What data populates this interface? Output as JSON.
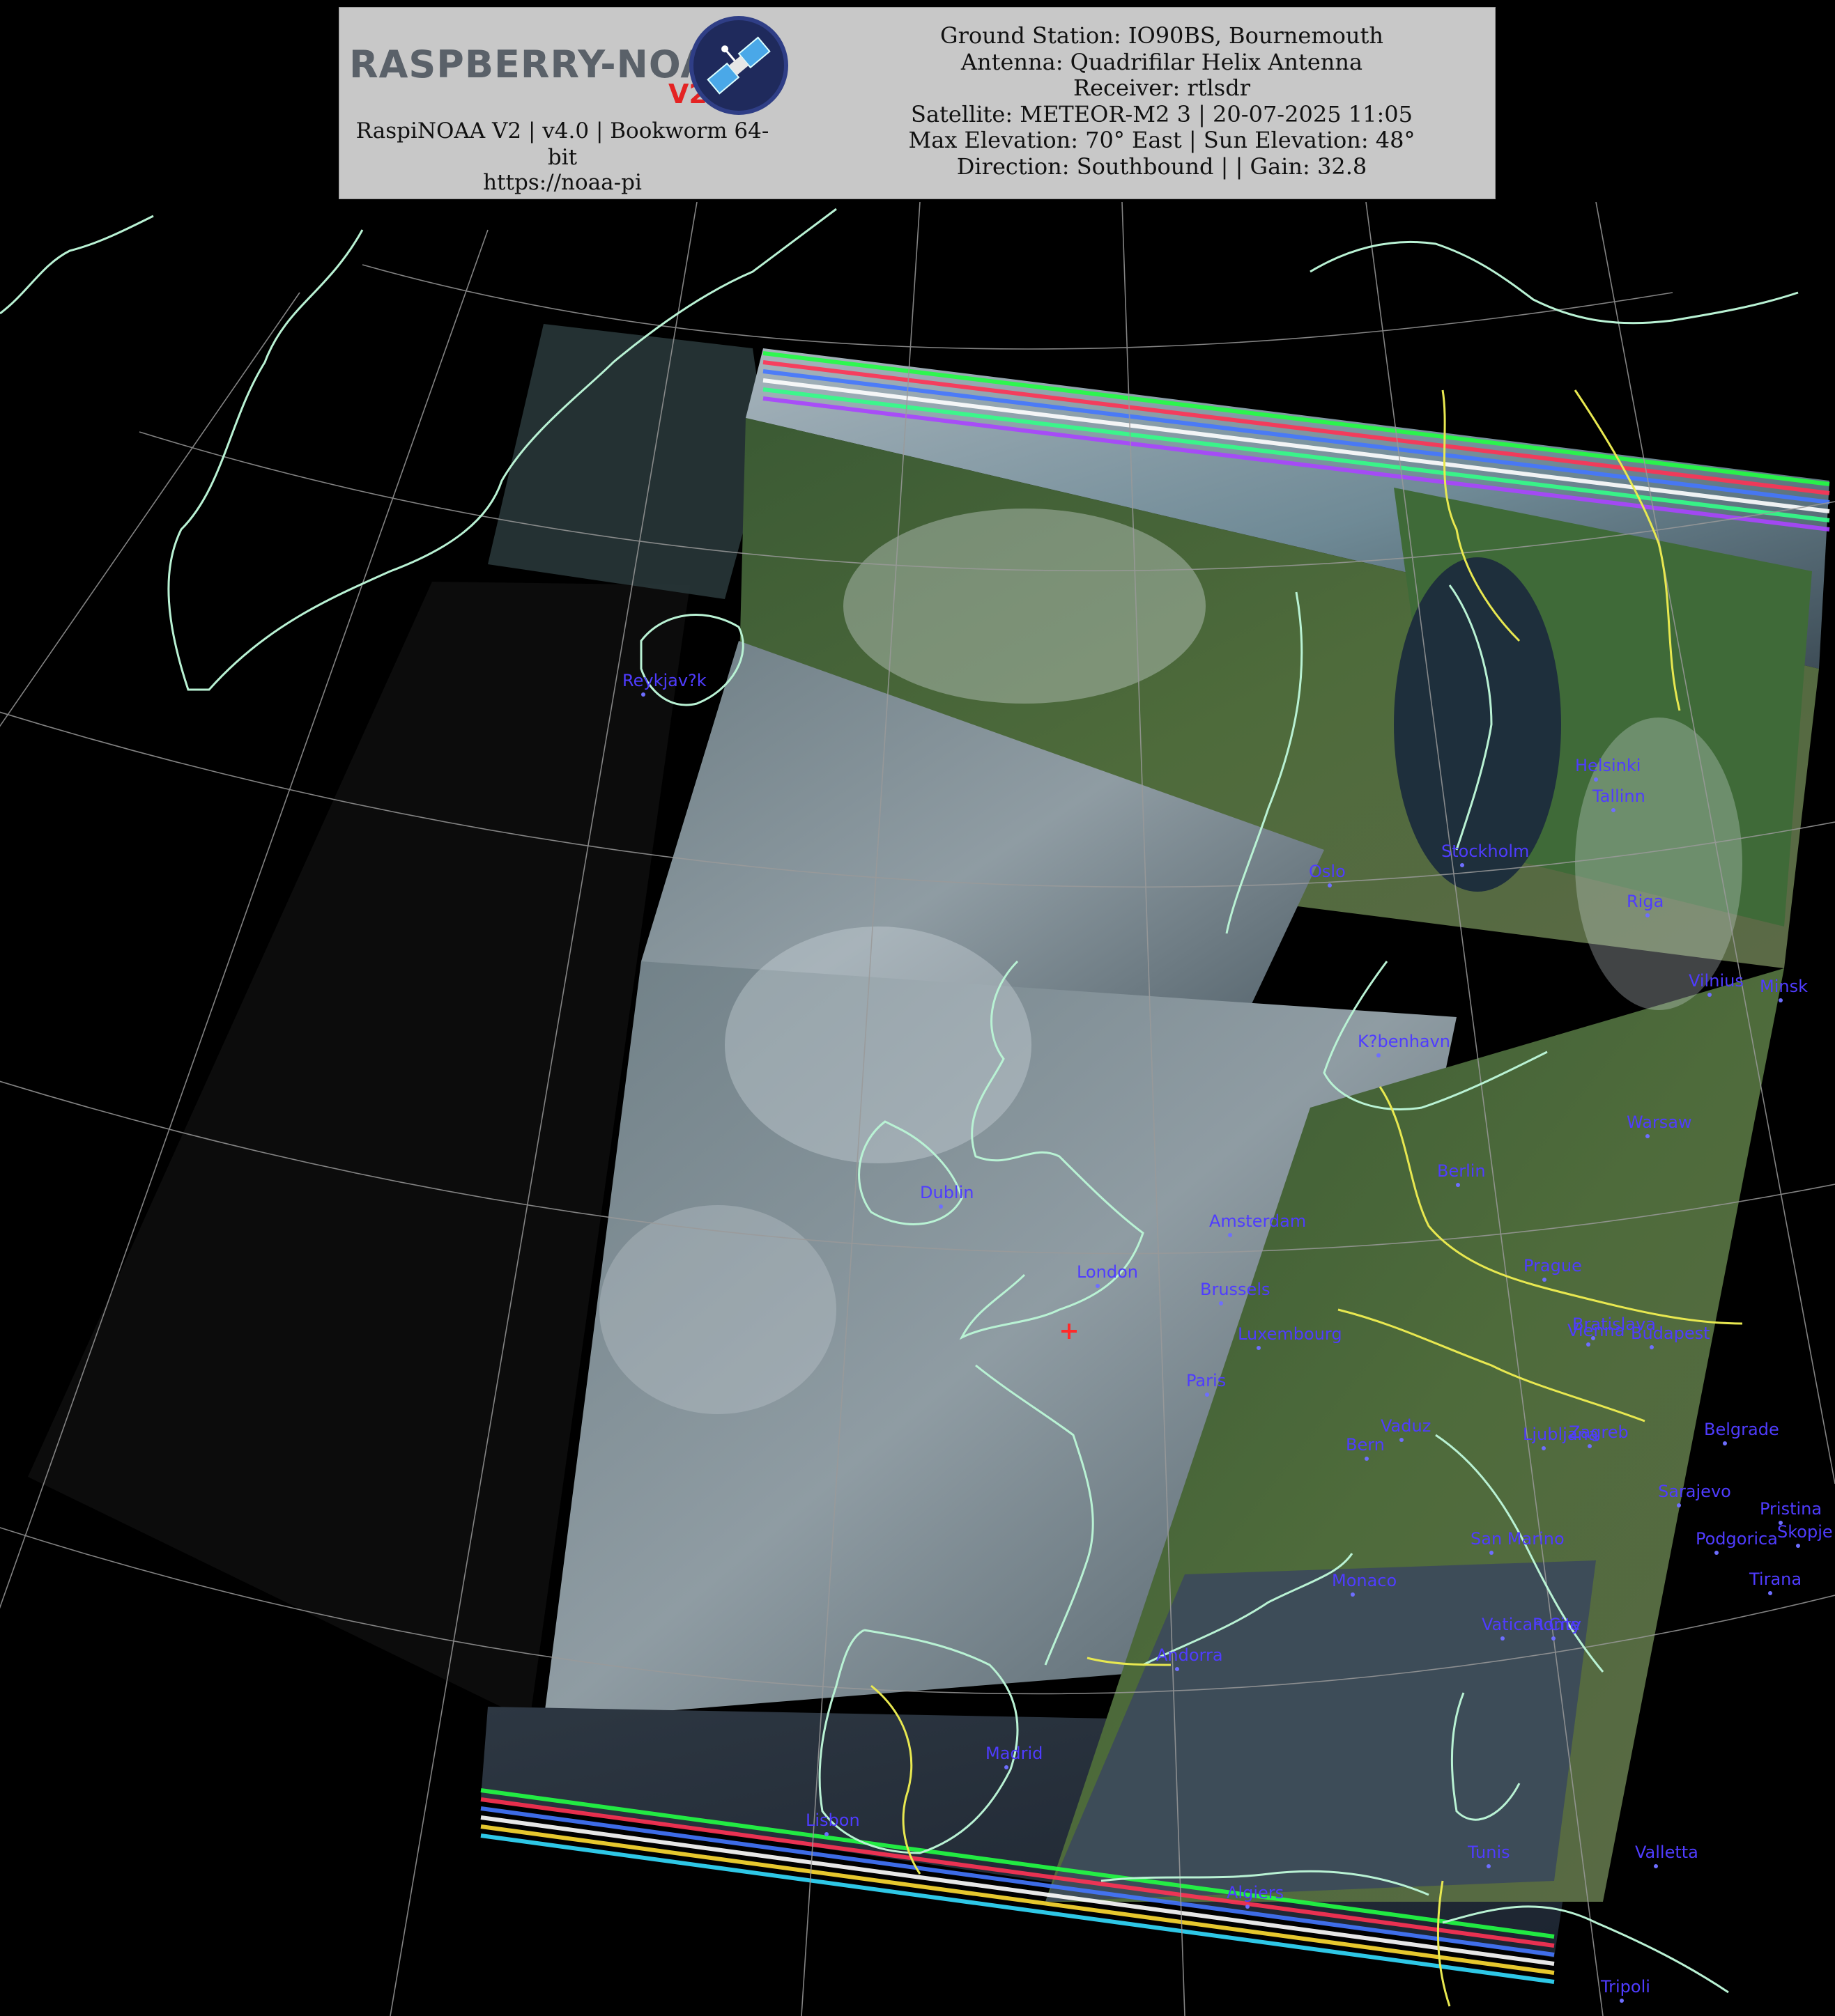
{
  "header": {
    "logo_text": "RASPBERRY-NOAA",
    "logo_badge": "V2",
    "version_line_1": "RaspiNOAA V2 | v4.0 | Bookworm 64-",
    "version_line_2": "bit",
    "url": "https://noaa-pi",
    "info_lines": [
      "Ground Station: IO90BS, Bournemouth",
      "Antenna: Quadrifilar Helix Antenna",
      "Receiver: rtlsdr",
      "Satellite: METEOR-M2 3 | 20-07-2025 11:05",
      "Max Elevation: 70° East | Sun Elevation: 48°",
      "Direction: Southbound | | Gain: 32.8"
    ]
  },
  "colors": {
    "header_bg": "#c8c8c8",
    "coastline": "#b9f2d4",
    "border": "#e8e850",
    "graticule": "#9a9a9a",
    "city_label": "#4f3cff",
    "station_marker": "#ff2a2a"
  },
  "cities": [
    {
      "name": "Reykjav?k"
    },
    {
      "name": "Helsinki"
    },
    {
      "name": "Tallinn"
    },
    {
      "name": "Stockholm"
    },
    {
      "name": "Oslo"
    },
    {
      "name": "Riga"
    },
    {
      "name": "Vilnius"
    },
    {
      "name": "Minsk"
    },
    {
      "name": "K?benhavn"
    },
    {
      "name": "Warsaw"
    },
    {
      "name": "Berlin"
    },
    {
      "name": "Dublin"
    },
    {
      "name": "Amsterdam"
    },
    {
      "name": "London"
    },
    {
      "name": "Brussels"
    },
    {
      "name": "Prague"
    },
    {
      "name": "Bratislava"
    },
    {
      "name": "Vienna"
    },
    {
      "name": "Budapest"
    },
    {
      "name": "Luxembourg"
    },
    {
      "name": "Paris"
    },
    {
      "name": "Vaduz"
    },
    {
      "name": "Ljubljana"
    },
    {
      "name": "Zagreb"
    },
    {
      "name": "Belgrade"
    },
    {
      "name": "Bern"
    },
    {
      "name": "Sarajevo"
    },
    {
      "name": "Pristina"
    },
    {
      "name": "San Marino"
    },
    {
      "name": "Podgorica"
    },
    {
      "name": "Skopje"
    },
    {
      "name": "Monaco"
    },
    {
      "name": "Tirana"
    },
    {
      "name": "Vatican City"
    },
    {
      "name": "Rome"
    },
    {
      "name": "Andorra"
    },
    {
      "name": "Madrid"
    },
    {
      "name": "Lisbon"
    },
    {
      "name": "Tunis"
    },
    {
      "name": "Valletta"
    },
    {
      "name": "Algiers"
    },
    {
      "name": "Tripoli"
    }
  ]
}
